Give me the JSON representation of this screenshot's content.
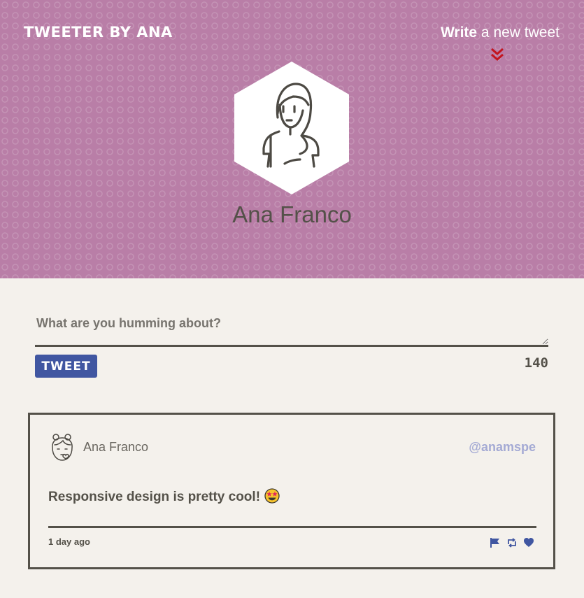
{
  "header": {
    "brand": "TWEETER BY ANA",
    "compose_link_bold": "Write",
    "compose_link_rest": " a new tweet",
    "chevron_icon": "double-chevron-down-icon",
    "chevron_color": "#c3141e"
  },
  "profile": {
    "name": "Ana Franco",
    "avatar_icon": "woman-avatar-icon"
  },
  "composer": {
    "placeholder": "What are you humming about?",
    "value": "",
    "button_label": "TWEET",
    "counter": "140"
  },
  "tweets": [
    {
      "avatar_icon": "girl-avatar-icon",
      "name": "Ana Franco",
      "handle": "@anamspe",
      "text": "Responsive design is pretty cool!",
      "emoji": "star-struck-emoji",
      "time": "1 day ago",
      "actions": [
        "flag-icon",
        "retweet-icon",
        "heart-icon"
      ]
    }
  ],
  "colors": {
    "hero_bg": "#b97ea7",
    "page_bg": "#f4f1ec",
    "text_dark": "#545149",
    "button_bg": "#4056a1",
    "handle_color": "#a4aad4"
  }
}
